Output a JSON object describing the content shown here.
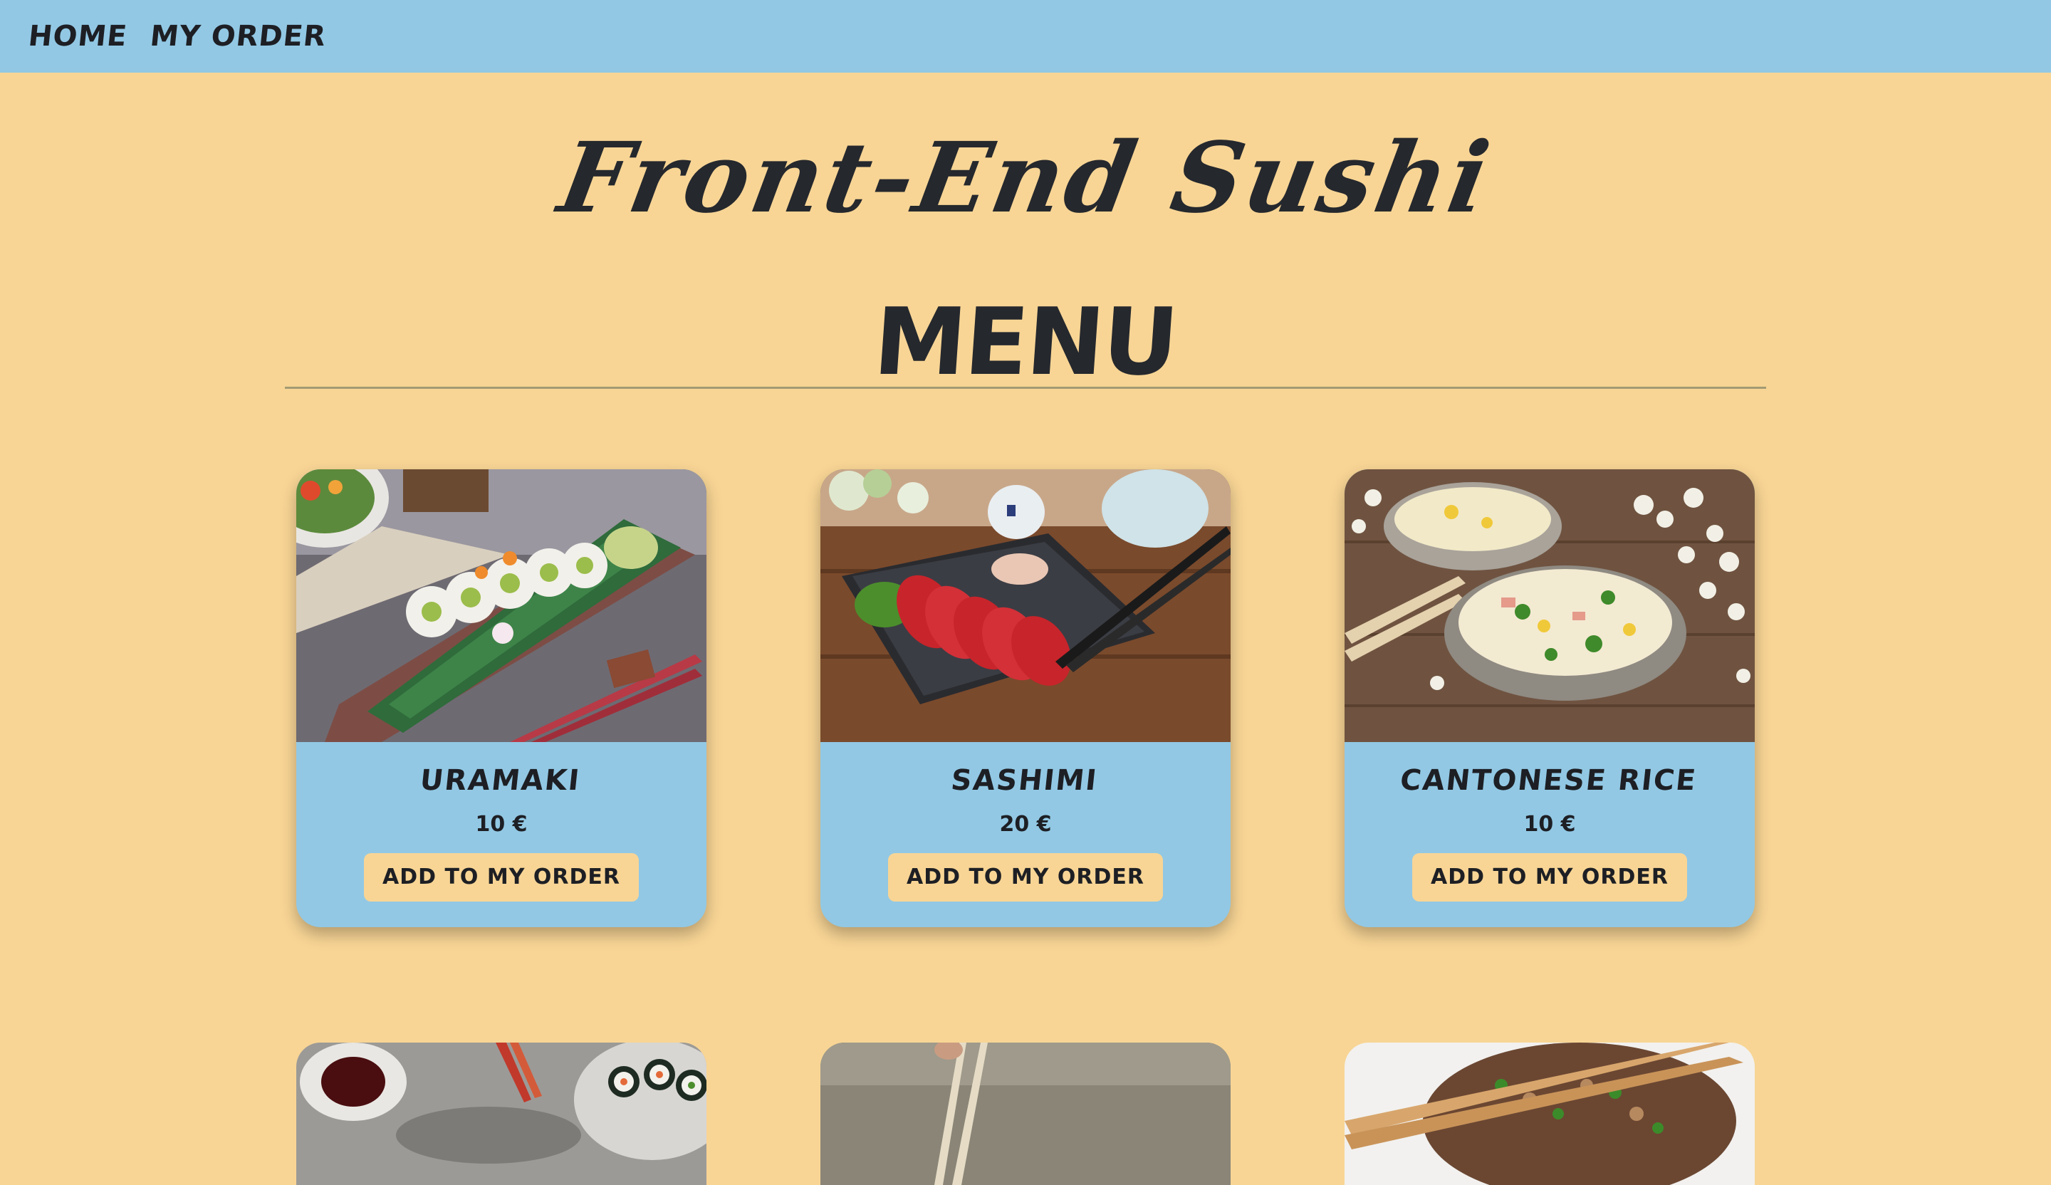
{
  "nav": {
    "home": "HOME",
    "my_order": "MY ORDER"
  },
  "site_title": "Front-End Sushi",
  "menu_heading": "MENU",
  "colors": {
    "background": "#f8d595",
    "navbar": "#92c8e4",
    "card_body": "#92c8e4",
    "button": "#f8d595",
    "text": "#1d1f24"
  },
  "add_button_label": "ADD TO MY ORDER",
  "dishes": [
    {
      "name": "URAMAKI",
      "price": "10 €",
      "image": "uramaki-photo"
    },
    {
      "name": "SASHIMI",
      "price": "20 €",
      "image": "sashimi-photo"
    },
    {
      "name": "CANTONESE RICE",
      "price": "10 €",
      "image": "cantonese-rice-photo"
    }
  ]
}
